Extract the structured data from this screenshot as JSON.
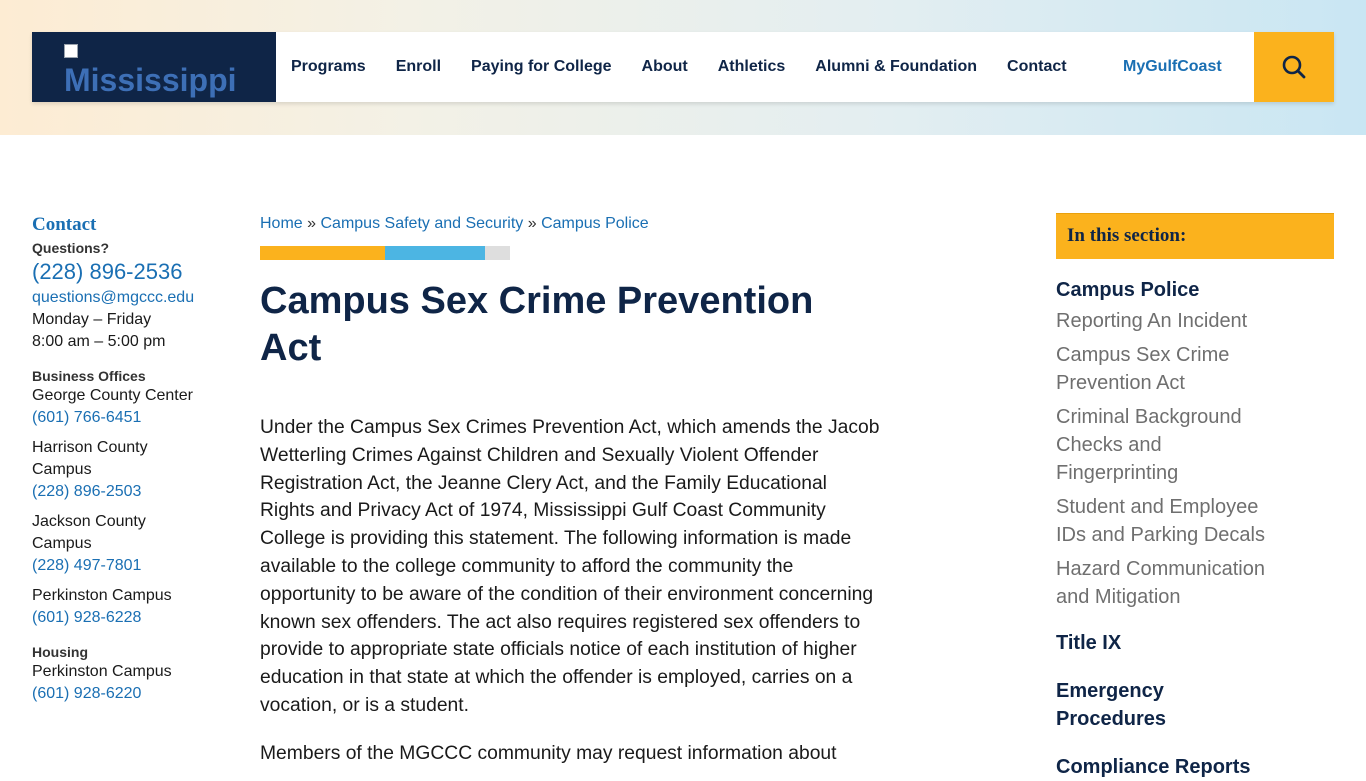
{
  "header": {
    "logo_alt": "Mississippi",
    "nav": [
      "Programs",
      "Enroll",
      "Paying for College",
      "About",
      "Athletics",
      "Alumni & Foundation",
      "Contact"
    ],
    "portal_link": "MyGulfCoast",
    "search_icon": "search-icon"
  },
  "left_sidebar": {
    "heading": "Contact",
    "questions_label": "Questions?",
    "phone": "(228) 896-2536",
    "email": "questions@mgccc.edu",
    "hours_days": "Monday – Friday",
    "hours_time": "8:00 am – 5:00 pm",
    "business_label": "Business Offices",
    "offices": [
      {
        "name": "George County Center",
        "phone": "(601) 766-6451"
      },
      {
        "name": "Harrison County Campus",
        "phone": "(228) 896-2503"
      },
      {
        "name": "Jackson County Campus",
        "phone": "(228) 497-7801"
      },
      {
        "name": "Perkinston Campus",
        "phone": "(601) 928-6228"
      }
    ],
    "housing_label": "Housing",
    "housing": {
      "name": "Perkinston Campus",
      "phone": "(601) 928-6220"
    }
  },
  "main": {
    "breadcrumb": [
      {
        "label": "Home"
      },
      {
        "label": "Campus Safety and Security"
      },
      {
        "label": "Campus Police"
      }
    ],
    "breadcrumb_sep": "»",
    "accent_colors": [
      "#fbb21d",
      "#4cb5e3",
      "#dedede"
    ],
    "title": "Campus Sex Crime Prevention Act",
    "paragraphs": [
      "Under the Campus Sex Crimes Prevention Act, which amends the Jacob Wetterling Crimes Against Children and Sexually Violent Offender Registration Act, the Jeanne Clery Act, and the Family Educational Rights and Privacy Act of 1974, Mississippi Gulf Coast Community College is providing this statement. The following information is made available to the college community to afford the community the opportunity to be aware of the condition of their environment concerning known sex offenders. The act also requires registered sex offenders to provide to appropriate state officials notice of each institution of higher education in that state at which the offender is employed, carries on a vocation, or is a student.",
      "Members of the MGCCC community may request information about"
    ]
  },
  "right_sidebar": {
    "heading": "In this section:",
    "active": "Campus Police",
    "sub_items": [
      "Reporting An Incident",
      "Campus Sex Crime Prevention Act",
      "Criminal Background Checks and Fingerprinting",
      "Student and Employee IDs and Parking Decals",
      "Hazard Communication and Mitigation"
    ],
    "top_items": [
      "Title IX",
      "Emergency Procedures",
      "Compliance Reports"
    ]
  },
  "colors": {
    "navy": "#0f2547",
    "link_blue": "#1a6fb3",
    "gold": "#fbb21d",
    "sky": "#4cb5e3"
  }
}
